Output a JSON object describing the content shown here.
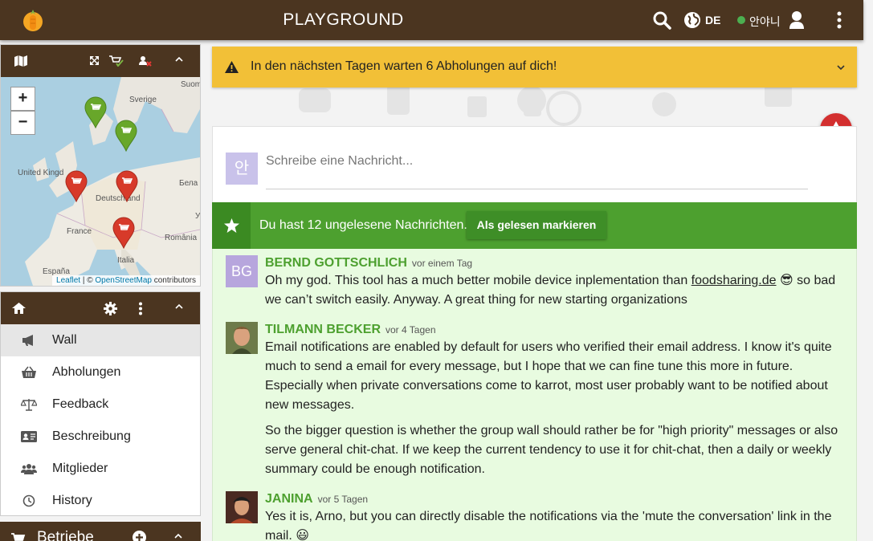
{
  "topbar": {
    "title": "PLAYGROUND",
    "language": "DE",
    "user_name": "안야니",
    "icons": [
      "carrot-logo-icon",
      "search-icon",
      "globe-icon",
      "user-icon",
      "more-vertical-icon"
    ]
  },
  "banner": {
    "text": "In den nächsten Tagen warten 6 Abholungen auf dich!"
  },
  "map": {
    "zoom_in": "+",
    "zoom_out": "−",
    "labels": {
      "suomi": "Suom",
      "sverige": "Sverige",
      "uk": "United Kingd",
      "deutschland": "Deutschland",
      "france": "France",
      "italia": "Italia",
      "romania": "România",
      "belarus": "Бела",
      "espana": "España",
      "ukraine": "У"
    },
    "attribution": {
      "leaflet": "Leaflet",
      "sep": " | © ",
      "osm": "OpenStreetMap",
      "contrib": " contributors"
    },
    "markers": [
      {
        "status": "active",
        "color": "#68a72a"
      },
      {
        "status": "active",
        "color": "#68a72a"
      },
      {
        "status": "inactive",
        "color": "#d73a2a"
      },
      {
        "status": "inactive",
        "color": "#d73a2a"
      },
      {
        "status": "inactive",
        "color": "#d73a2a"
      }
    ]
  },
  "nav": {
    "items": [
      {
        "label": "Wall",
        "icon": "megaphone-icon",
        "active": true
      },
      {
        "label": "Abholungen",
        "icon": "basket-icon",
        "active": false
      },
      {
        "label": "Feedback",
        "icon": "balance-scale-icon",
        "active": false
      },
      {
        "label": "Beschreibung",
        "icon": "id-card-icon",
        "active": false
      },
      {
        "label": "Mitglieder",
        "icon": "users-icon",
        "active": false
      },
      {
        "label": "History",
        "icon": "clock-icon",
        "active": false
      }
    ]
  },
  "stores": {
    "title": "Betriebe"
  },
  "composer": {
    "placeholder": "Schreibe eine Nachricht...",
    "avatar_text": "안"
  },
  "unread": {
    "text": "Du hast 12 ungelesene Nachrichten.",
    "button": "Als gelesen markieren"
  },
  "messages": [
    {
      "author": "BERND GOTTSCHLICH",
      "time": "vor einem Tag",
      "avatar_text": "BG",
      "text_before_link": "Oh my god. This tool has a much better mobile device inplementation than ",
      "link": "foodsharing.de",
      "text_after_link": " 😎 so bad",
      "text_line2": "we can’t switch easily. Anyway. A great thing for new starting organizations"
    },
    {
      "author": "TILMANN BECKER",
      "time": "vor 4 Tagen",
      "paragraph1": "Email notifications are enabled by default for users who verified their email address. I know it's quite much to send a email for every message, but I hope that we can fine tune this more in future. Especially when private conversations come to karrot, most user probably want to be notified about new messages.",
      "paragraph2": "So the bigger question is whether the group wall should rather be for \"high priority\" messages or also serve general chit-chat. If we keep the current tendency to use it for chit-chat, then a daily or weekly summary could be enough notification."
    },
    {
      "author": "JANINA",
      "time": "vor 5 Tagen",
      "text": "Yes it is, Arno, but you can directly disable the notifications via the 'mute the conversation' link in the mail. 😃"
    }
  ],
  "colors": {
    "topbar": "#4b3520",
    "banner": "#f2c037",
    "unread_bar": "#4da02f",
    "author": "#4da02f",
    "message_bg": "#e8fbe0",
    "warning_fab": "#d32f2f"
  }
}
